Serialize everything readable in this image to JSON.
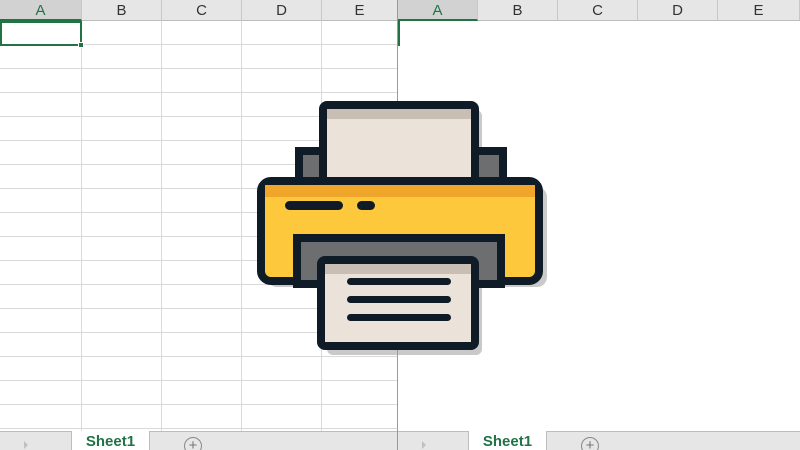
{
  "columns": [
    "A",
    "B",
    "C",
    "D",
    "E"
  ],
  "sheet_tab": "Sheet1",
  "add_sheet_icon": "plus-circle-icon",
  "illustration": "printer-icon",
  "colors": {
    "accent": "#217346",
    "printer_body": "#fdc83c",
    "outline": "#0f1b26",
    "paper": "#ebe3da"
  }
}
